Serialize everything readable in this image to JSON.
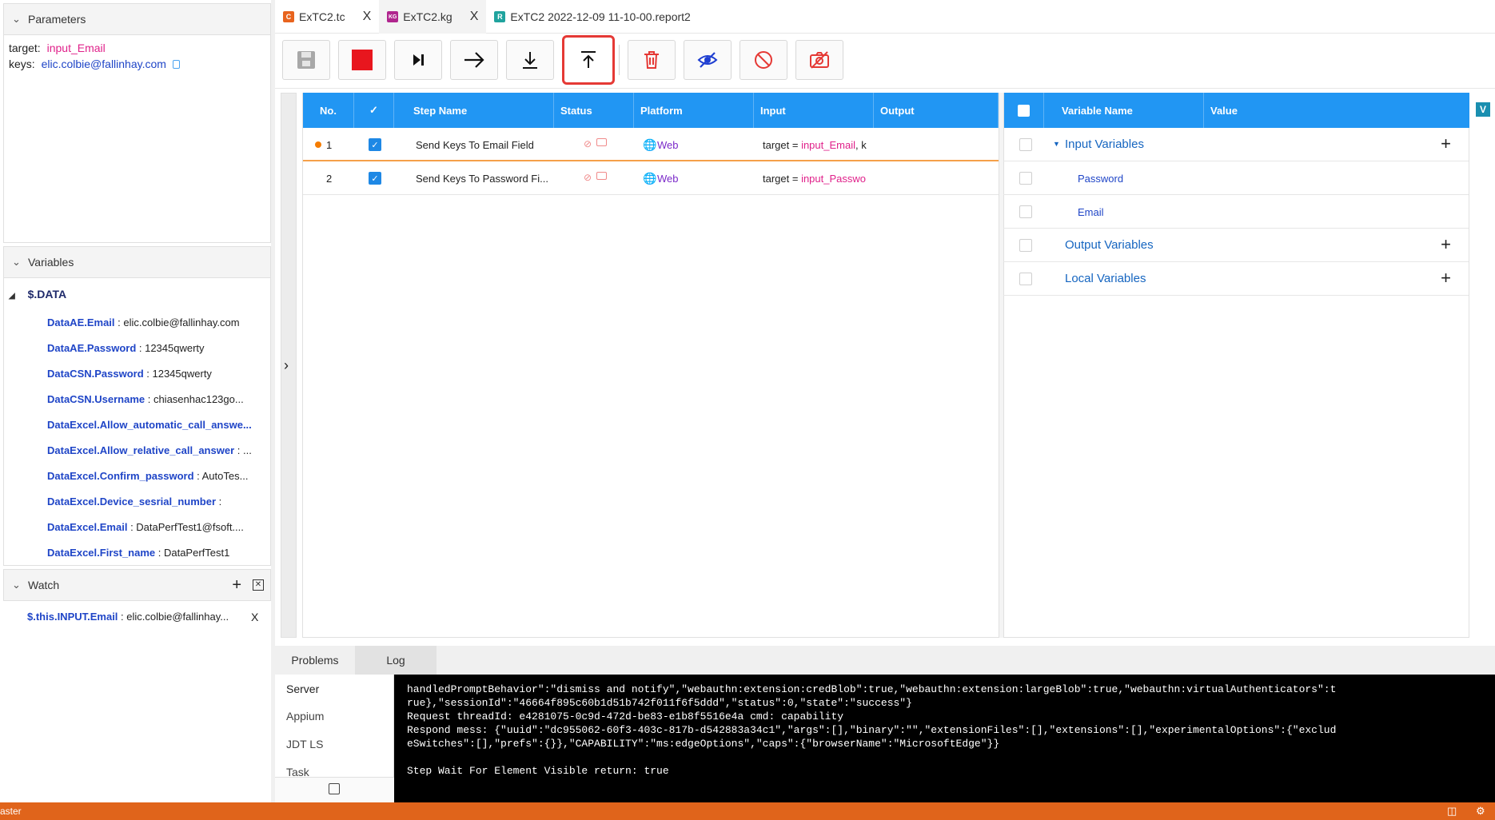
{
  "parameters": {
    "title": "Parameters",
    "target_label": "target:",
    "target_value": "input_Email",
    "keys_label": "keys:",
    "keys_value": "elic.colbie@fallinhay.com"
  },
  "variables": {
    "title": "Variables",
    "root": "$.DATA",
    "items": [
      {
        "key": "DataAE.Email",
        "value": " : elic.colbie@fallinhay.com"
      },
      {
        "key": "DataAE.Password",
        "value": " : 12345qwerty"
      },
      {
        "key": "DataCSN.Password",
        "value": " : 12345qwerty"
      },
      {
        "key": "DataCSN.Username",
        "value": " : chiasenhac123go..."
      },
      {
        "key": "DataExcel.Allow_automatic_call_answe...",
        "value": ""
      },
      {
        "key": "DataExcel.Allow_relative_call_answer",
        "value": " : ..."
      },
      {
        "key": "DataExcel.Confirm_password",
        "value": " : AutoTes..."
      },
      {
        "key": "DataExcel.Device_sesrial_number",
        "value": " :"
      },
      {
        "key": "DataExcel.Email",
        "value": " : DataPerfTest1@fsoft...."
      },
      {
        "key": "DataExcel.First_name",
        "value": " : DataPerfTest1"
      }
    ]
  },
  "watch": {
    "title": "Watch",
    "item_key": "$.this.INPUT.Email",
    "item_value": " : elic.colbie@fallinhay...",
    "item_close": "X"
  },
  "tabs": [
    {
      "label": "ExTC2.tc",
      "icon": "C",
      "color": "#e8641e"
    },
    {
      "label": "ExTC2.kg",
      "icon": "KG",
      "color": "#b0258e"
    },
    {
      "label": "ExTC2 2022-12-09 11-10-00.report2",
      "icon": "R",
      "color": "#20a39e"
    }
  ],
  "tab_close": "X",
  "toolbar": [
    "save-icon",
    "stop-icon",
    "step-over-icon",
    "next-step-icon",
    "download-icon",
    "upload-icon",
    "delete-icon",
    "hide-icon",
    "disable-icon",
    "no-screenshot-icon"
  ],
  "steps_table": {
    "headers": {
      "no": "No.",
      "step_name": "Step Name",
      "status": "Status",
      "platform": "Platform",
      "input": "Input",
      "output": "Output"
    },
    "rows": [
      {
        "no": "1",
        "name": "Send Keys To Email Field",
        "platform": "Web",
        "input_prefix": "target = ",
        "input_value": "input_Email",
        "input_suffix": ", k"
      },
      {
        "no": "2",
        "name": "Send Keys To Password Fi...",
        "platform": "Web",
        "input_prefix": "target = ",
        "input_value": "input_Passwo",
        "input_suffix": ""
      }
    ]
  },
  "vars_table": {
    "headers": {
      "name": "Variable Name",
      "value": "Value"
    },
    "input_group": "Input Variables",
    "input_items": [
      "Password",
      "Email"
    ],
    "output_group": "Output Variables",
    "local_group": "Local Variables",
    "side_badge": "V"
  },
  "bottom": {
    "tabs": [
      "Problems",
      "Log"
    ],
    "side_items": [
      "Server",
      "Appium",
      "JDT LS",
      "Task"
    ],
    "log_lines": [
      "handledPromptBehavior\":\"dismiss and notify\",\"webauthn:extension:credBlob\":true,\"webauthn:extension:largeBlob\":true,\"webauthn:virtualAuthenticators\":t",
      "rue},\"sessionId\":\"46664f895c60b1d51b742f011f6f5ddd\",\"status\":0,\"state\":\"success\"}",
      "Request threadId: e4281075-0c9d-472d-be83-e1b8f5516e4a cmd: capability",
      "Respond mess: {\"uuid\":\"dc955062-60f3-403c-817b-d542883a34c1\",\"args\":[],\"binary\":\"\",\"extensionFiles\":[],\"extensions\":[],\"experimentalOptions\":{\"exclud",
      "eSwitches\":[],\"prefs\":{}},\"CAPABILITY\":\"ms:edgeOptions\",\"caps\":{\"browserName\":\"MicrosoftEdge\"}}",
      "",
      "Step Wait For Element Visible return: true"
    ]
  },
  "statusbar": {
    "branch": "aster"
  },
  "colors": {
    "accent": "#2196f3",
    "highlight": "#e53935",
    "statusbar": "#e0641b",
    "link": "#1f45c7",
    "magenta": "#e0218a"
  }
}
